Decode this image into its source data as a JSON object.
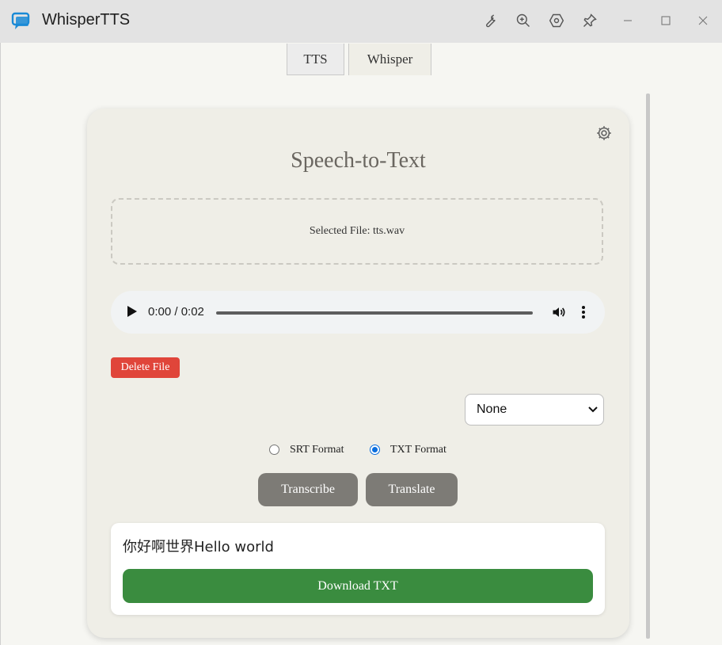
{
  "window": {
    "title": "WhisperTTS",
    "icons": [
      "app-chat-icon",
      "wrench-icon",
      "zoom-in-icon",
      "settings-hex-icon",
      "pin-icon",
      "minimize-icon",
      "maximize-icon",
      "close-icon"
    ]
  },
  "tabs": [
    {
      "label": "TTS",
      "active": false
    },
    {
      "label": "Whisper",
      "active": true
    }
  ],
  "main": {
    "heading": "Speech-to-Text",
    "dropzone_text": "Selected File: tts.wav",
    "player": {
      "time": "0:00 / 0:02"
    },
    "delete_label": "Delete File",
    "language_select": {
      "selected": "None"
    },
    "format_options": [
      {
        "label": "SRT Format",
        "checked": false
      },
      {
        "label": "TXT Format",
        "checked": true
      }
    ],
    "transcribe_label": "Transcribe",
    "translate_label": "Translate",
    "result_text": "你好啊世界Hello world",
    "download_label": "Download TXT"
  },
  "colors": {
    "accent_green": "#3a8c3f",
    "delete_red": "#e0453a",
    "button_gray": "#7d7b76",
    "card_bg": "#efeee7",
    "radio_blue": "#0b6ede"
  }
}
